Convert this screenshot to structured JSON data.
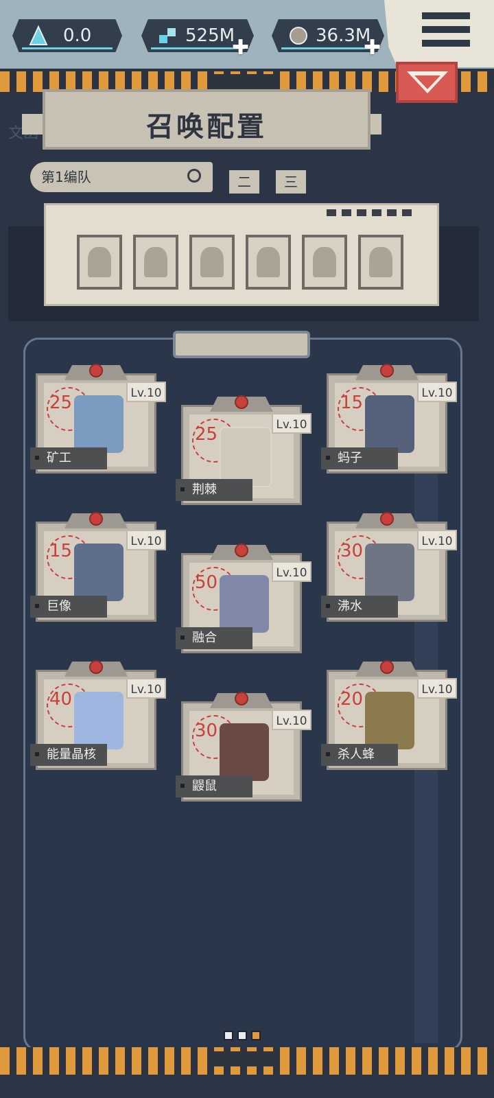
{
  "resources": [
    {
      "icon": "triangle-gem-icon",
      "value": "0.0"
    },
    {
      "icon": "crystal-icon",
      "value": "525M"
    },
    {
      "icon": "ore-icon",
      "value": "36.3M"
    }
  ],
  "header": {
    "title": "召唤配置",
    "ghost_label": "文函"
  },
  "team": {
    "selected": "第1编队",
    "tabs": [
      "二",
      "三"
    ]
  },
  "units": [
    {
      "name": "矿工",
      "cost": "25",
      "level": "Lv.10"
    },
    {
      "name": "荆棘",
      "cost": "25",
      "level": "Lv.10"
    },
    {
      "name": "蚂子",
      "cost": "15",
      "level": "Lv.10"
    },
    {
      "name": "巨像",
      "cost": "15",
      "level": "Lv.10"
    },
    {
      "name": "融合",
      "cost": "50",
      "level": "Lv.10"
    },
    {
      "name": "沸水",
      "cost": "30",
      "level": "Lv.10"
    },
    {
      "name": "能量晶核",
      "cost": "40",
      "level": "Lv.10"
    },
    {
      "name": "鼹鼠",
      "cost": "30",
      "level": "Lv.10"
    },
    {
      "name": "杀人蜂",
      "cost": "20",
      "level": "Lv.10"
    }
  ],
  "colors": {
    "accent_orange": "#e09a3e",
    "badge_red": "#c8403b",
    "panel_blue": "#2a364a"
  },
  "pager": {
    "pages": 3,
    "current": 3
  }
}
